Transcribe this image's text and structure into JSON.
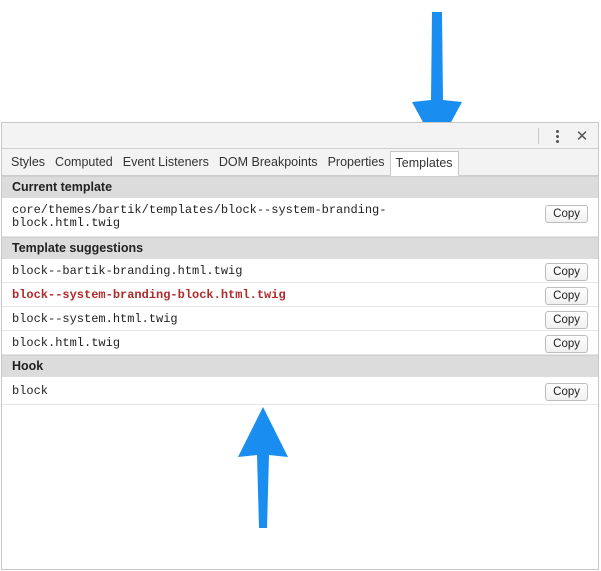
{
  "toolbar": {
    "more_icon": "more-vertical-icon",
    "close_icon": "close-icon",
    "close_glyph": "✕"
  },
  "tabs": [
    {
      "label": "Styles"
    },
    {
      "label": "Computed"
    },
    {
      "label": "Event Listeners"
    },
    {
      "label": "DOM Breakpoints"
    },
    {
      "label": "Properties"
    },
    {
      "label": "Templates",
      "active": true
    }
  ],
  "sections": {
    "current_template": {
      "header": "Current template",
      "path_line1": "core/themes/bartik/templates/block--system-branding-",
      "path_line2": "block.html.twig",
      "copy_label": "Copy"
    },
    "suggestions": {
      "header": "Template suggestions",
      "items": [
        {
          "name": "block--bartik-branding.html.twig",
          "copy_label": "Copy"
        },
        {
          "name": "block--system-branding-block.html.twig",
          "copy_label": "Copy"
        },
        {
          "name": "block--system.html.twig",
          "copy_label": "Copy"
        },
        {
          "name": "block.html.twig",
          "copy_label": "Copy"
        }
      ]
    },
    "hook": {
      "header": "Hook",
      "value": "block",
      "copy_label": "Copy"
    }
  },
  "colors": {
    "arrow": "#1a8ef0",
    "active_suggestion": "#b02a2a",
    "section_header_bg": "#dcdcdc"
  }
}
